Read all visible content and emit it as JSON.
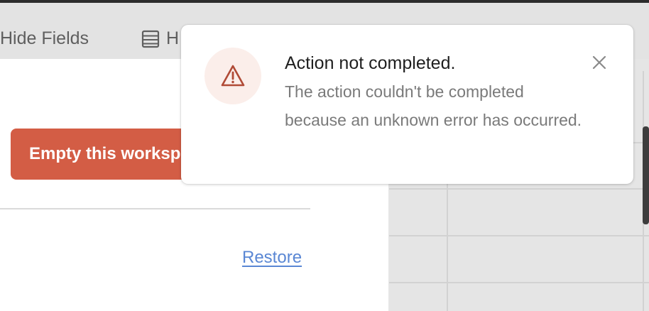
{
  "toolbar": {
    "hide_fields_label": "Hide Fields",
    "second_item_label": "H",
    "second_item_icon": "list-icon"
  },
  "panel": {
    "danger_button_label": "Empty this workspace",
    "restore_link_label": "Restore"
  },
  "toast": {
    "icon": "warning-triangle-icon",
    "title": "Action not completed.",
    "message": "The action couldn't be completed because an unknown error has occurred.",
    "close_icon": "close-icon"
  },
  "colors": {
    "danger": "#d35d45",
    "link": "#5a87d4",
    "warning_icon": "#b04a36",
    "warning_icon_bg": "#fbeeea"
  }
}
